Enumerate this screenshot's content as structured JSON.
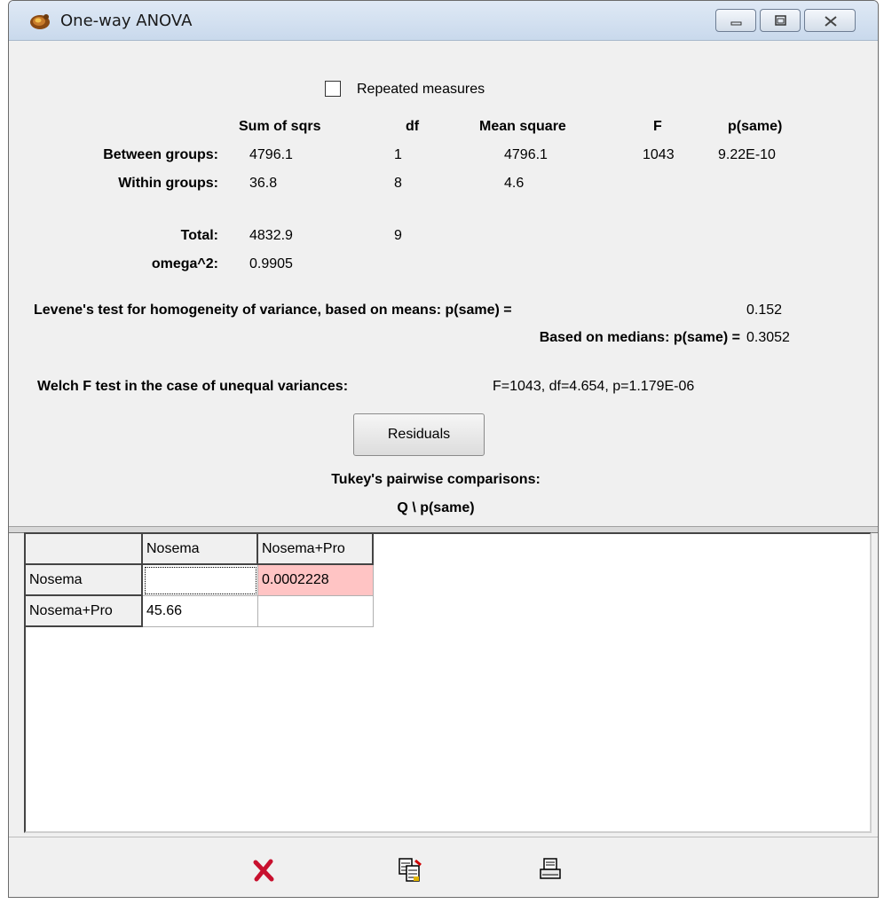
{
  "window": {
    "title": "One-way ANOVA",
    "icon": "ammonite-icon",
    "controls": [
      "minimize-icon",
      "maximize-icon",
      "close-icon"
    ]
  },
  "options": {
    "repeated_measures_label": "Repeated measures",
    "repeated_measures_checked": false
  },
  "anova": {
    "headers": {
      "sum_of_squares": "Sum of sqrs",
      "df": "df",
      "mean_square": "Mean square",
      "f": "F",
      "p": "p(same)"
    },
    "between": {
      "label": "Between groups:",
      "ss": "4796.1",
      "df": "1",
      "ms": "4796.1",
      "f": "1043",
      "p": "9.22E-10"
    },
    "within": {
      "label": "Within groups:",
      "ss": "36.8",
      "df": "8",
      "ms": "4.6"
    },
    "total": {
      "label": "Total:",
      "ss": "4832.9",
      "df": "9"
    },
    "omega": {
      "label": "omega^2:",
      "value": "0.9905"
    }
  },
  "levene": {
    "means_label": "Levene's test for homogeneity of variance, based on means:  p(same) =",
    "means_value": "0.152",
    "medians_label": "Based on medians: p(same) =",
    "medians_value": "0.3052"
  },
  "welch": {
    "label": "Welch F test in the case of unequal variances:",
    "value": "F=1043, df=4.654, p=1.179E-06"
  },
  "residuals_button": "Residuals",
  "tukey": {
    "title": "Tukey's pairwise comparisons:",
    "subtitle": "Q \\ p(same)",
    "columns": [
      "",
      "Nosema",
      "Nosema+Pro"
    ],
    "rows": [
      {
        "label": "Nosema",
        "cells": [
          "",
          "0.0002228"
        ]
      },
      {
        "label": "Nosema+Pro",
        "cells": [
          "45.66",
          ""
        ]
      }
    ]
  },
  "toolbar": {
    "close_icon": "red-x-close-icon",
    "copy_icon": "copy-icon",
    "print_icon": "print-icon"
  }
}
